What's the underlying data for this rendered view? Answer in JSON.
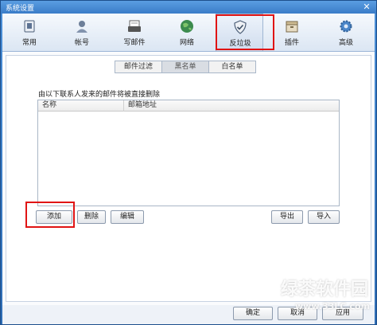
{
  "window": {
    "title": "系统设置",
    "close_glyph": "✕"
  },
  "toolbar": {
    "items": [
      {
        "label": "常用",
        "icon": "common-icon"
      },
      {
        "label": "帐号",
        "icon": "account-icon"
      },
      {
        "label": "写邮件",
        "icon": "compose-icon"
      },
      {
        "label": "网络",
        "icon": "network-icon"
      },
      {
        "label": "反垃圾",
        "icon": "shield-icon",
        "active": true
      },
      {
        "label": "插件",
        "icon": "plugin-icon"
      },
      {
        "label": "高级",
        "icon": "gear-icon"
      }
    ]
  },
  "tabs": [
    {
      "label": "邮件过滤",
      "active": false
    },
    {
      "label": "黑名单",
      "active": true
    },
    {
      "label": "白名单",
      "active": false
    }
  ],
  "blacklist": {
    "description": "由以下联系人发来的邮件将被直接删除",
    "columns": [
      "名称",
      "邮箱地址"
    ],
    "rows": []
  },
  "buttons": {
    "add": "添加",
    "delete": "删除",
    "edit": "编辑",
    "export": "导出",
    "import": "导入",
    "ok": "确定",
    "cancel": "取消",
    "apply": "应用"
  },
  "watermark": {
    "main": "绿茶软件园",
    "url": "www.33LC.com"
  },
  "colors": {
    "highlight": "#e01414",
    "titlebar": "#3a7cc8"
  }
}
